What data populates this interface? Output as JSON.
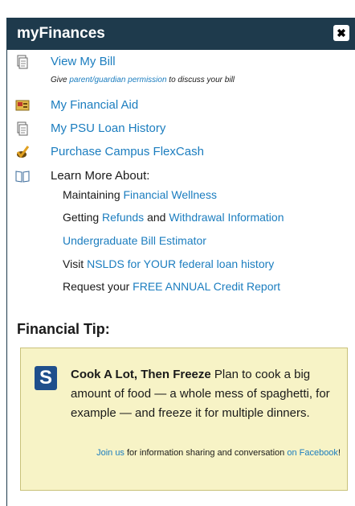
{
  "window": {
    "title": "myFinances",
    "close_glyph": "✖"
  },
  "menu": {
    "view_bill": "View My Bill",
    "note_pre": "Give ",
    "note_link": "parent/guardian permission",
    "note_post": " to discuss your bill",
    "financial_aid": "My Financial Aid",
    "loan_history": "My PSU Loan History",
    "flexcash": "Purchase Campus FlexCash",
    "learn_more": "Learn More About:"
  },
  "learn": {
    "wellness_pre": "Maintaining ",
    "wellness_link": "Financial Wellness",
    "refunds_pre": "Getting ",
    "refunds_link": "Refunds",
    "refunds_mid": " and ",
    "withdrawal_link": "Withdrawal Information",
    "estimator_link": "Undergraduate Bill Estimator",
    "nslds_pre": "Visit ",
    "nslds_link": "NSLDS for YOUR federal loan history",
    "credit_pre": "Request your ",
    "credit_link": "FREE ANNUAL Credit Report"
  },
  "tip": {
    "heading": "Financial Tip:",
    "logo_letter": "S",
    "title": "Cook A Lot, Then Freeze",
    "body": " Plan to cook a big amount of food — a whole mess of spaghetti, for example — and freeze it for multiple dinners.",
    "join_link": "Join us",
    "join_text": " for information sharing and conversation ",
    "on_link": "on Facebook",
    "bang": "!"
  },
  "colors": {
    "titlebar": "#1e3a4c",
    "link": "#1b7dbf",
    "tip_bg": "#f7f3c6",
    "logo": "#1f4f8c"
  },
  "icons": [
    "document-icon",
    "financial-aid-icon",
    "document-icon",
    "checkmark-icon",
    "book-icon"
  ]
}
